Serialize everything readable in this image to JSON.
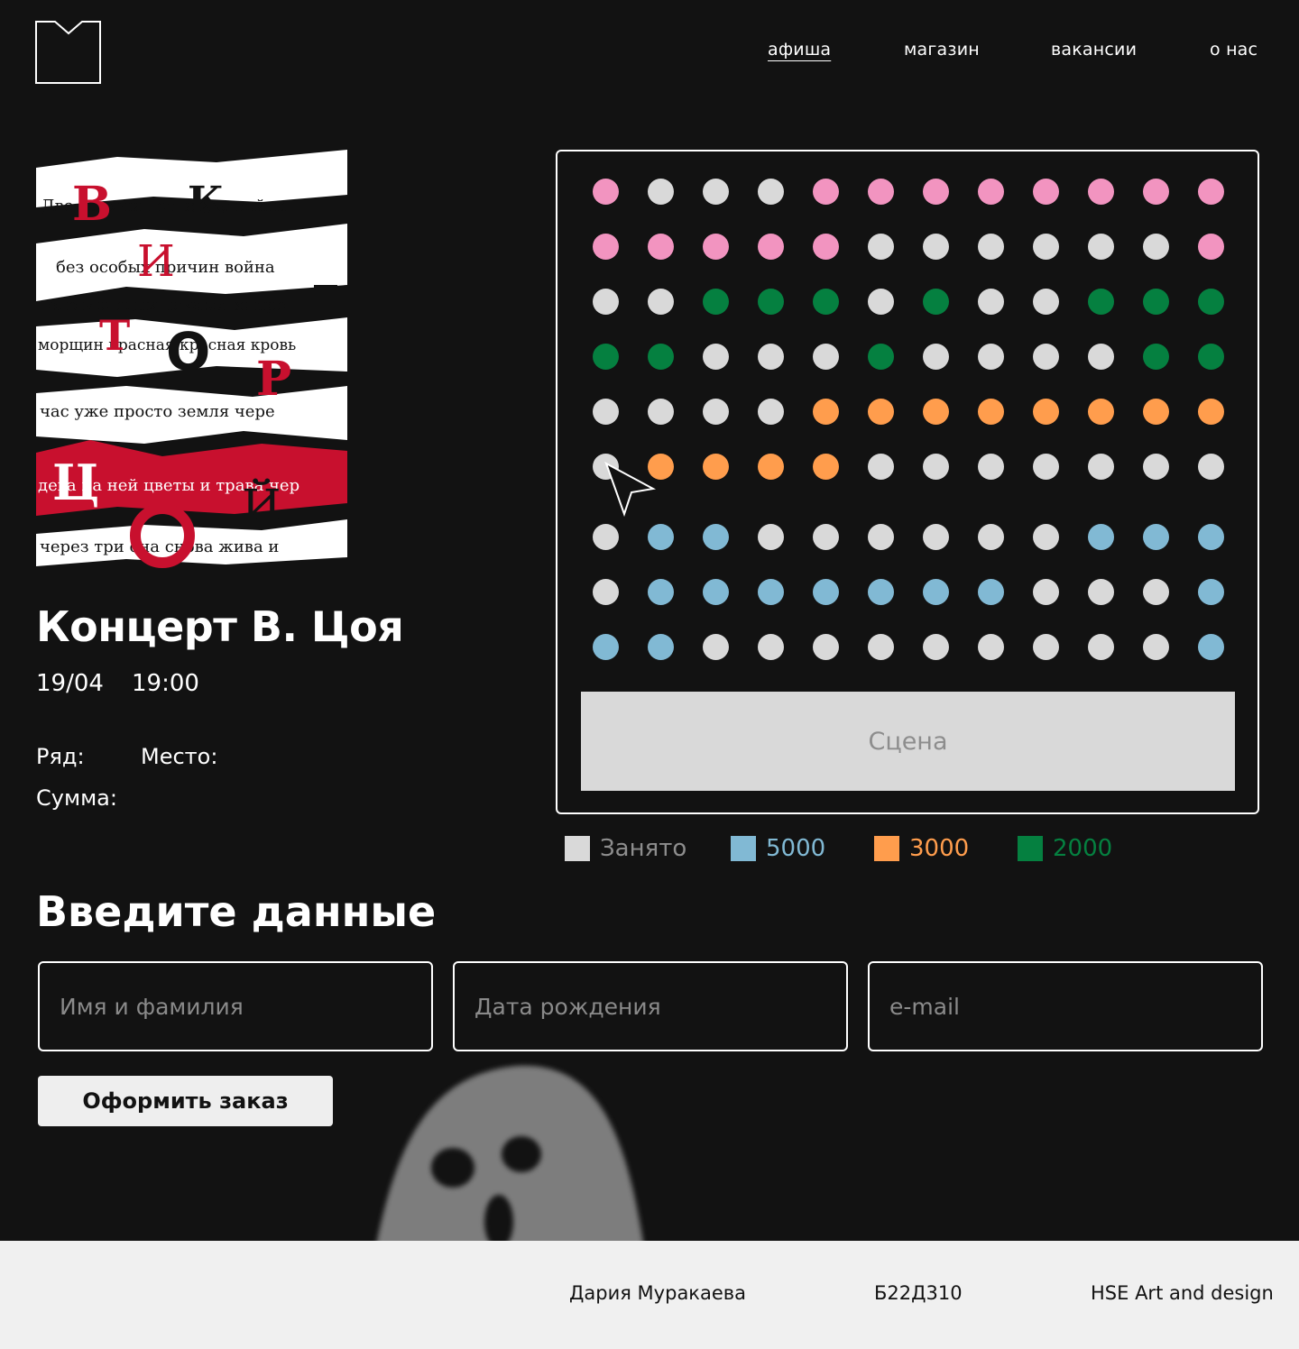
{
  "nav": {
    "items": [
      {
        "label": "афиша",
        "active": true
      },
      {
        "label": "магазин",
        "active": false
      },
      {
        "label": "вакансии",
        "active": false
      },
      {
        "label": "о нас",
        "active": false
      }
    ]
  },
  "event": {
    "title": "Концерт В. Цоя",
    "date": "19/04",
    "time": "19:00",
    "row_label": "Ряд:",
    "seat_label": "Место:",
    "sum_label": "Сумма:"
  },
  "seatmap": {
    "stage_label": "Сцена",
    "rows": [
      [
        "1000",
        "busy",
        "busy",
        "busy",
        "1000",
        "1000",
        "1000",
        "1000",
        "1000",
        "1000",
        "1000",
        "1000"
      ],
      [
        "1000",
        "1000",
        "1000",
        "1000",
        "1000",
        "busy",
        "busy",
        "busy",
        "busy",
        "busy",
        "busy",
        "1000"
      ],
      [
        "busy",
        "busy",
        "2000",
        "2000",
        "2000",
        "busy",
        "2000",
        "busy",
        "busy",
        "2000",
        "2000",
        "2000"
      ],
      [
        "2000",
        "2000",
        "busy",
        "busy",
        "busy",
        "2000",
        "busy",
        "busy",
        "busy",
        "busy",
        "2000",
        "2000"
      ],
      [
        "busy",
        "busy",
        "busy",
        "busy",
        "3000",
        "3000",
        "3000",
        "3000",
        "3000",
        "3000",
        "3000",
        "3000"
      ],
      [
        "busy",
        "3000",
        "3000",
        "3000",
        "3000",
        "busy",
        "busy",
        "busy",
        "busy",
        "busy",
        "busy",
        "busy"
      ],
      [
        "busy",
        "5000",
        "5000",
        "busy",
        "busy",
        "busy",
        "busy",
        "busy",
        "busy",
        "5000",
        "5000",
        "5000"
      ],
      [
        "busy",
        "5000",
        "5000",
        "5000",
        "5000",
        "5000",
        "5000",
        "5000",
        "busy",
        "busy",
        "busy",
        "5000"
      ],
      [
        "5000",
        "5000",
        "busy",
        "busy",
        "busy",
        "busy",
        "busy",
        "busy",
        "busy",
        "busy",
        "busy",
        "5000"
      ]
    ],
    "colors": {
      "busy": "#d9d9d9",
      "5000": "#81b9d4",
      "3000": "#ff9d4d",
      "2000": "#058040",
      "1000": "#f294c0"
    }
  },
  "legend": [
    {
      "label": "Занято",
      "color": "#d9d9d9",
      "text_color": "#8d8d8d"
    },
    {
      "label": "5000",
      "color": "#81b9d4",
      "text_color": "#81b9d4"
    },
    {
      "label": "3000",
      "color": "#ff9d4d",
      "text_color": "#ff9d4d"
    },
    {
      "label": "2000",
      "color": "#058040",
      "text_color": "#058040"
    }
  ],
  "form": {
    "title": "Введите данные",
    "name_placeholder": "Имя и фамилия",
    "birth_placeholder": "Дата рождения",
    "email_placeholder": "e-mail",
    "submit_label": "Оформить заказ"
  },
  "footer": {
    "author": "Дария Муракаева",
    "group": "Б22Д310",
    "org": "HSE Art and design"
  }
}
